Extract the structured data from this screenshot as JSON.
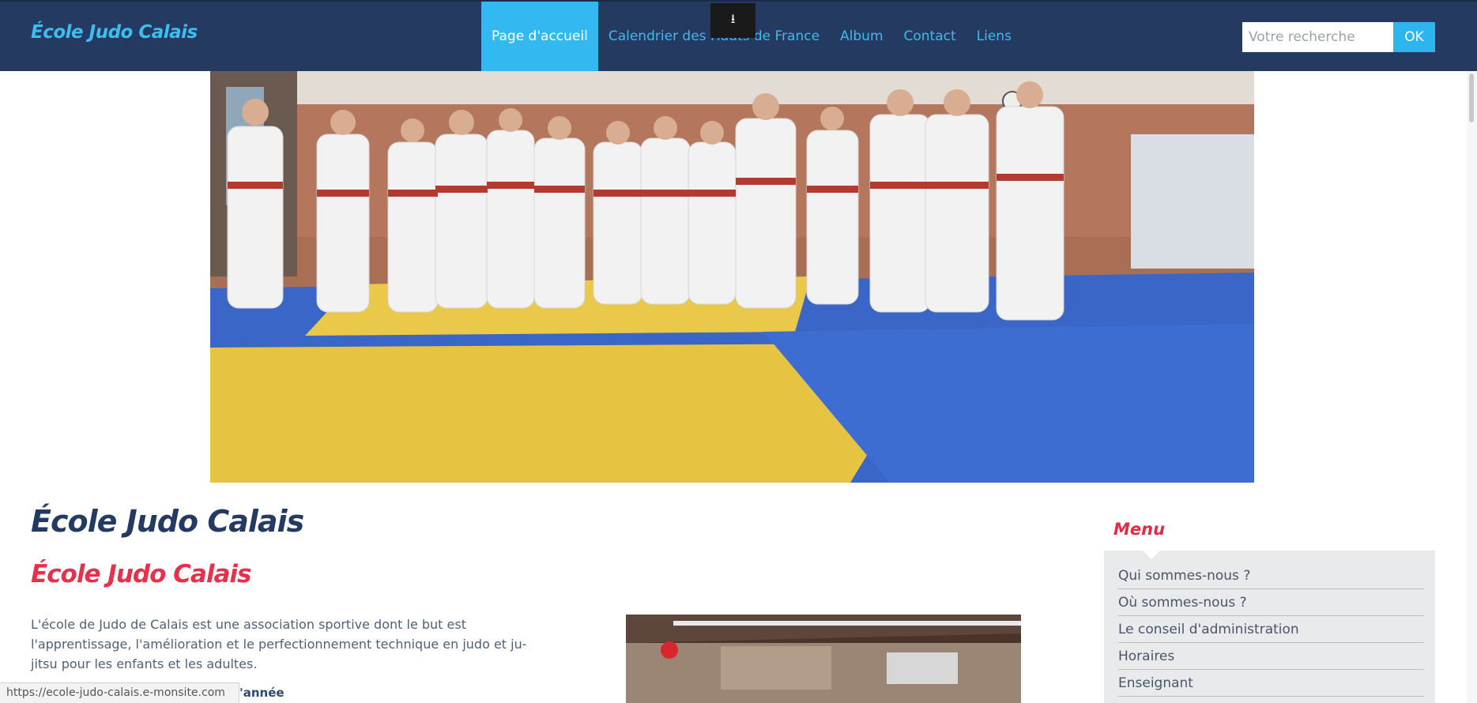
{
  "navbar": {
    "brand": "École Judo Calais",
    "items": [
      {
        "label": "Page d'accueil",
        "active": true
      },
      {
        "label": "Calendrier des Hauts de France",
        "active": false
      },
      {
        "label": "Album",
        "active": false
      },
      {
        "label": "Contact",
        "active": false
      },
      {
        "label": "Liens",
        "active": false
      }
    ],
    "download_icon": "download-icon"
  },
  "search": {
    "placeholder": "Votre recherche",
    "button_label": "OK"
  },
  "main": {
    "page_title": "École Judo Calais",
    "section_title": "École Judo Calais",
    "intro": "L'école de Judo de Calais est une association sportive dont le but est l'apprentissage, l'amélioration et le perfectionnement technique en judo et ju-jitsu pour les enfants et les adultes.",
    "subtitle_fragment": "l'année"
  },
  "status_bar": {
    "url": "https://ecole-judo-calais.e-monsite.com"
  },
  "sidebar": {
    "title": "Menu",
    "items": [
      {
        "label": "Qui sommes-nous ?"
      },
      {
        "label": "Où sommes-nous ?"
      },
      {
        "label": "Le conseil d'administration"
      },
      {
        "label": "Horaires"
      },
      {
        "label": "Enseignant"
      }
    ]
  },
  "colors": {
    "navbar": "#243a60",
    "accent": "#33b8ef",
    "title_red": "#e8304a"
  }
}
